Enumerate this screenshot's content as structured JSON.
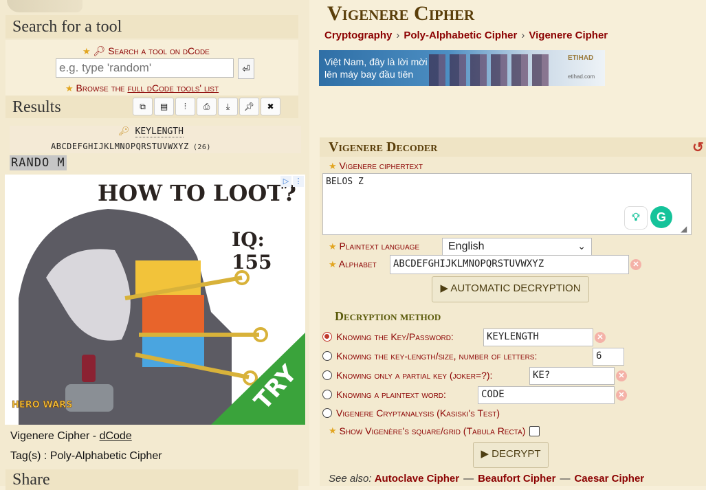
{
  "search": {
    "title": "Search for a tool",
    "link_label": "Search a tool on dCode",
    "placeholder": "e.g. type 'random'",
    "browse_prefix": "Browse the",
    "browse_link": "full dCode tools' list"
  },
  "results": {
    "title": "Results",
    "key": "KEYLENGTH",
    "alphabet": "ABCDEFGHIJKLMNOPQRSTUVWXYZ",
    "alphabet_count": "(26)",
    "output": "RANDO M"
  },
  "ad_left": {
    "headline": "HOW TO LOOT?",
    "iq": "IQ: 155",
    "cta": "TRY",
    "brand": "HERO WARS"
  },
  "page_info": {
    "title_text": "Vigenere Cipher -",
    "site_link": "dCode",
    "tags": "Tag(s) : Poly-Alphabetic Cipher"
  },
  "share": {
    "title": "Share"
  },
  "page": {
    "title": "Vigenere Cipher",
    "breadcrumbs": [
      "Cryptography",
      "Poly-Alphabetic Cipher",
      "Vigenere Cipher"
    ]
  },
  "ad_right": {
    "text_line1": "Việt Nam, đây là lời mời",
    "text_line2": "lên máy bay đầu tiên",
    "brand": "ETIHAD",
    "url": "etihad.com"
  },
  "decoder": {
    "title": "Vigenere Decoder",
    "ciphertext_label": "Vigenere ciphertext",
    "ciphertext": "BELOS Z",
    "language_label": "Plaintext language",
    "language": "English",
    "alphabet_label": "Alphabet",
    "alphabet": "ABCDEFGHIJKLMNOPQRSTUVWXYZ",
    "auto_button": "AUTOMATIC DECRYPTION",
    "method_title": "Decryption method",
    "methods": [
      {
        "label": "Knowing the Key/Password:",
        "value": "KEYLENGTH",
        "selected": true
      },
      {
        "label": "Knowing the key-length/size, number of letters:",
        "value": "6",
        "selected": false
      },
      {
        "label": "Knowing only a partial key (joker=?):",
        "value": "KE?",
        "selected": false
      },
      {
        "label": "Knowing a plaintext word:",
        "value": "CODE",
        "selected": false
      },
      {
        "label": "Vigenere Cryptanalysis (Kasiski's Test)",
        "selected": false
      }
    ],
    "grid_label": "Show Vigenère's square/grid (Tabula Recta)",
    "decrypt_button": "DECRYPT",
    "see_also_label": "See also:",
    "see_also": [
      "Autoclave Cipher",
      "Beaufort Cipher",
      "Caesar Cipher"
    ]
  },
  "colors": {
    "accent": "#8b0000",
    "title": "#5a3e0a",
    "panel": "#efe4c5",
    "background": "#f7efd9"
  }
}
